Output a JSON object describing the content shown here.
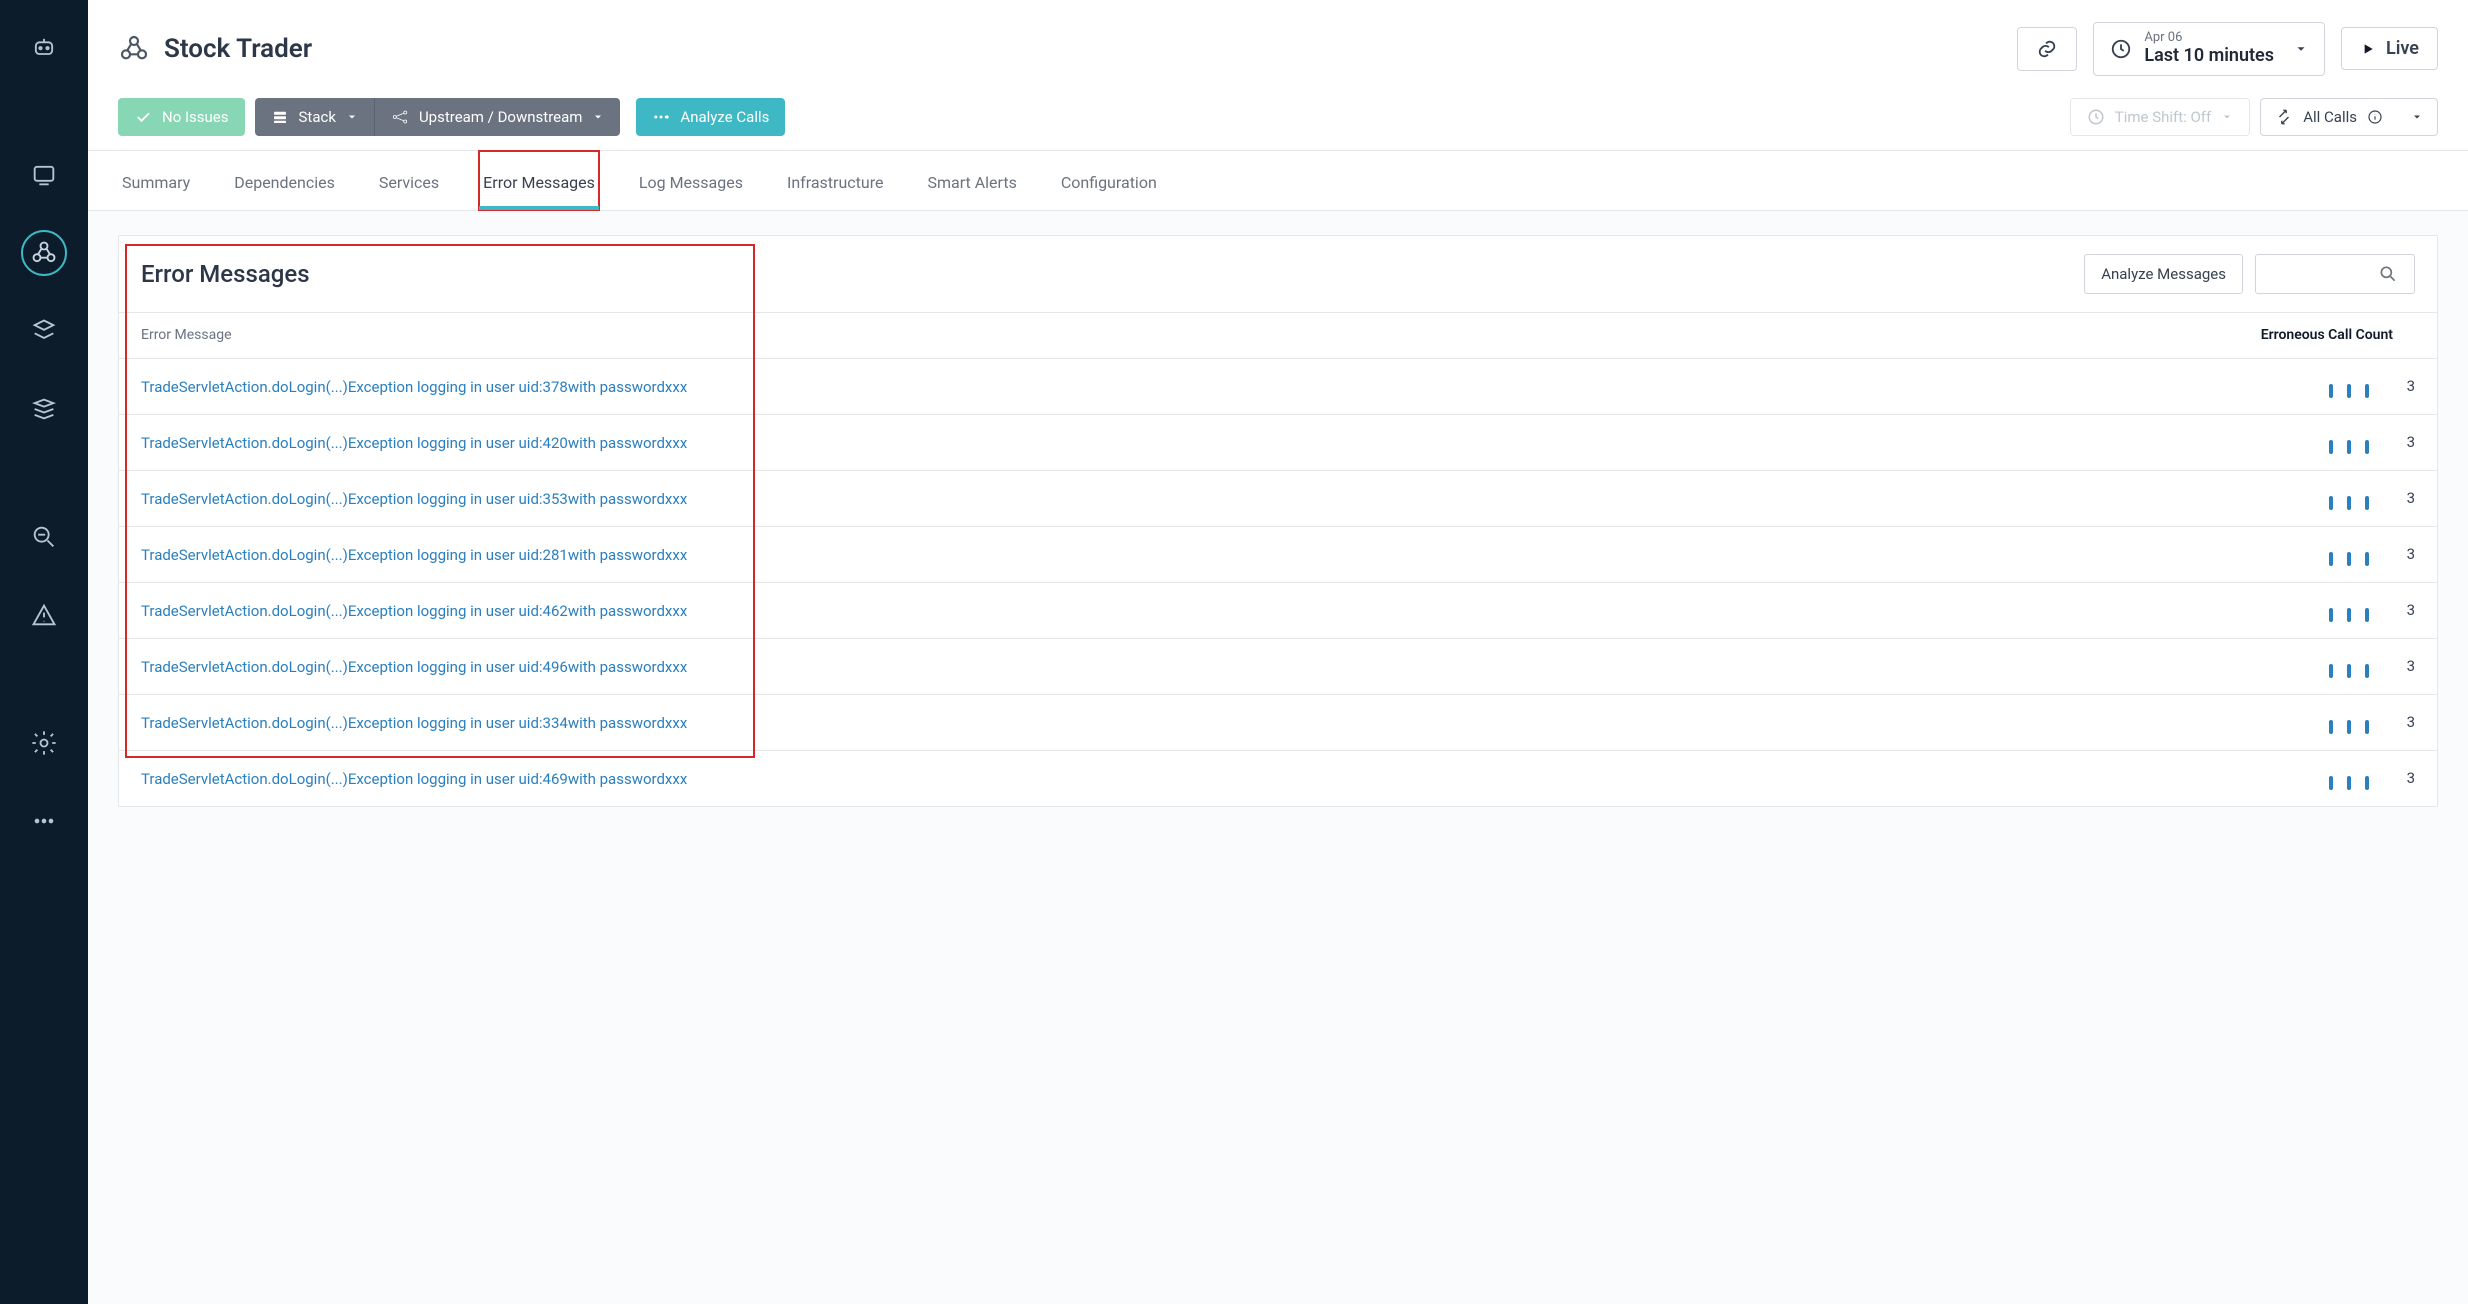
{
  "header": {
    "page_title": "Stock Trader",
    "time_date": "Apr 06",
    "time_range_label": "Last 10 minutes",
    "live_label": "Live"
  },
  "toolbar": {
    "no_issues": "No Issues",
    "stack": "Stack",
    "updown": "Upstream / Downstream",
    "analyze_calls": "Analyze Calls",
    "time_shift": "Time Shift: Off",
    "all_calls": "All Calls"
  },
  "tabs": [
    "Summary",
    "Dependencies",
    "Services",
    "Error Messages",
    "Log Messages",
    "Infrastructure",
    "Smart Alerts",
    "Configuration"
  ],
  "panel": {
    "title": "Error Messages",
    "analyze_btn": "Analyze Messages",
    "col_msg": "Error Message",
    "col_count": "Erroneous Call Count"
  },
  "rows": [
    {
      "msg": "TradeServletAction.doLogin(...)Exception logging in user uid:378with passwordxxx",
      "count": "3"
    },
    {
      "msg": "TradeServletAction.doLogin(...)Exception logging in user uid:420with passwordxxx",
      "count": "3"
    },
    {
      "msg": "TradeServletAction.doLogin(...)Exception logging in user uid:353with passwordxxx",
      "count": "3"
    },
    {
      "msg": "TradeServletAction.doLogin(...)Exception logging in user uid:281with passwordxxx",
      "count": "3"
    },
    {
      "msg": "TradeServletAction.doLogin(...)Exception logging in user uid:462with passwordxxx",
      "count": "3"
    },
    {
      "msg": "TradeServletAction.doLogin(...)Exception logging in user uid:496with passwordxxx",
      "count": "3"
    },
    {
      "msg": "TradeServletAction.doLogin(...)Exception logging in user uid:334with passwordxxx",
      "count": "3"
    },
    {
      "msg": "TradeServletAction.doLogin(...)Exception logging in user uid:469with passwordxxx",
      "count": "3"
    }
  ]
}
